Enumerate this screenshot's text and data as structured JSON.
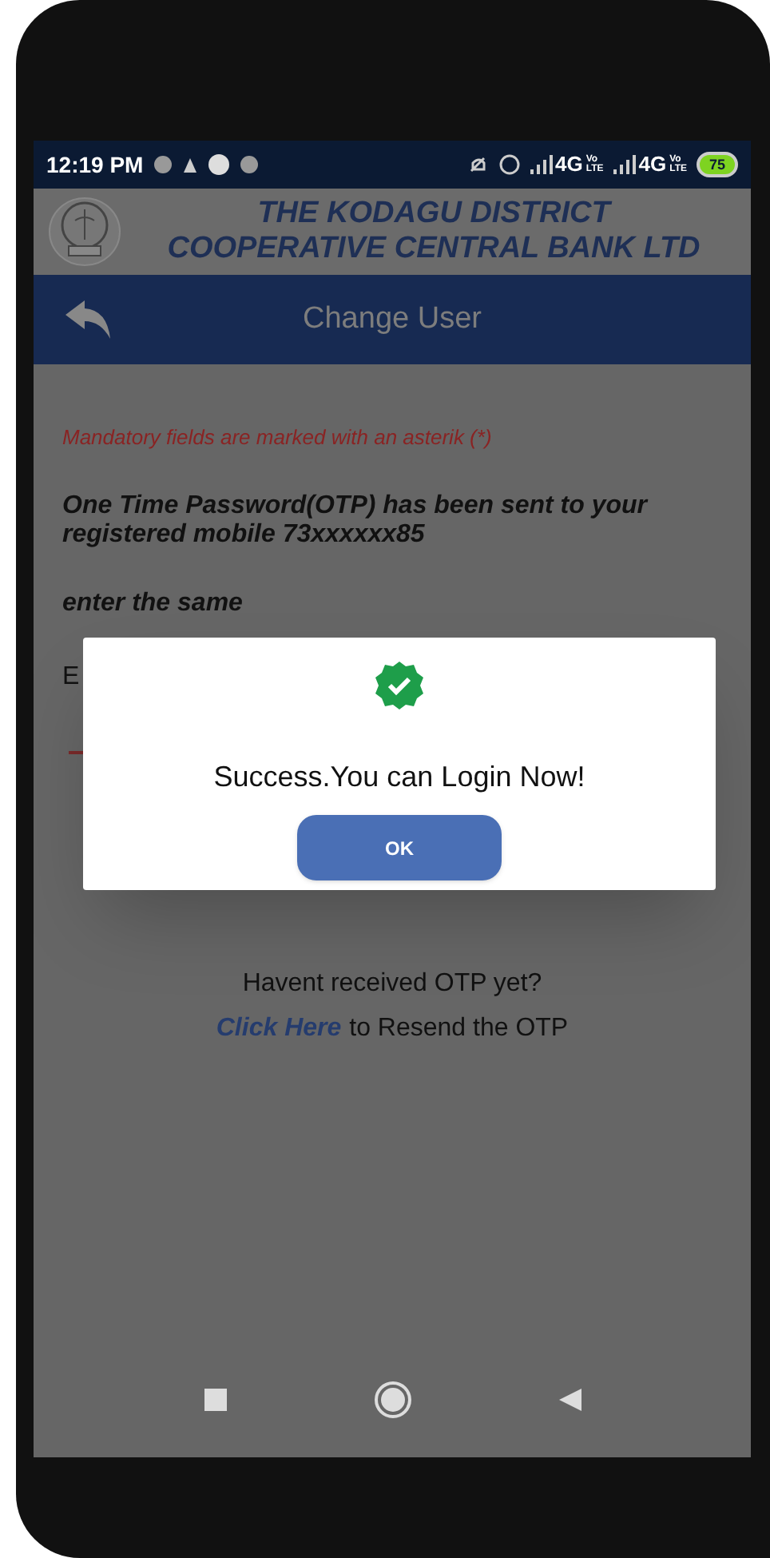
{
  "status_bar": {
    "time": "12:19 PM",
    "networks": [
      {
        "label": "4G",
        "volte_top": "Vo",
        "volte_bottom": "LTE"
      },
      {
        "label": "4G",
        "volte_top": "Vo",
        "volte_bottom": "LTE"
      }
    ],
    "battery": "75"
  },
  "header": {
    "title_line_1": "THE KODAGU DISTRICT",
    "title_line_2": "COOPERATIVE CENTRAL BANK LTD"
  },
  "toolbar": {
    "title": "Change User"
  },
  "form": {
    "mandatory_note": "Mandatory fields are marked with an asterik (*)",
    "otp_message": "One Time Password(OTP) has been sent to your registered mobile 73xxxxxx85",
    "instruction": "enter the same",
    "field_label_partial": "E"
  },
  "resend": {
    "question": "Havent received OTP yet?",
    "link": "Click Here",
    "rest": "to Resend the OTP"
  },
  "dialog": {
    "message": "Success.You can Login Now!",
    "button": "OK"
  }
}
